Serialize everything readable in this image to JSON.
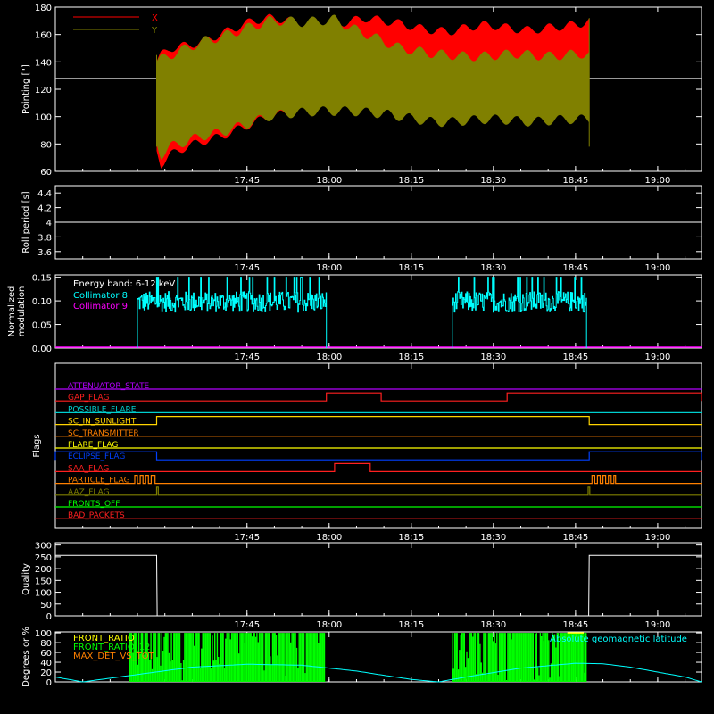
{
  "time_axis": {
    "tick_labels": [
      "17:45",
      "18:00",
      "18:15",
      "18:30",
      "18:45",
      "19:00"
    ],
    "tick_minutes": [
      1065,
      1080,
      1095,
      1110,
      1125,
      1140
    ],
    "range_minutes": [
      1030,
      1148
    ]
  },
  "chart_data": [
    {
      "id": "pointing",
      "type": "area",
      "ylabel": "Pointing [\"]",
      "ylim": [
        60,
        180
      ],
      "yticks": [
        60,
        80,
        100,
        120,
        140,
        160,
        180
      ],
      "legend": [
        {
          "name": "X",
          "color": "#ff0000"
        },
        {
          "name": "Y",
          "color": "#808000"
        }
      ],
      "reference_line": 128,
      "series": [
        {
          "name": "X",
          "color": "#ff0000",
          "x": [
            1048.5,
            1049.3,
            1051,
            1054,
            1057,
            1060,
            1063,
            1066,
            1069,
            1072,
            1075,
            1078,
            1081,
            1084,
            1087,
            1090,
            1093,
            1096,
            1099,
            1102,
            1105,
            1108,
            1111,
            1114,
            1117,
            1120,
            1123,
            1126,
            1127.5
          ],
          "upper": [
            140,
            145,
            150,
            152,
            155,
            160,
            165,
            170,
            172,
            171,
            168,
            165,
            167,
            170,
            172,
            170,
            168,
            165,
            163,
            162,
            165,
            167,
            166,
            164,
            163,
            165,
            166,
            168,
            170
          ],
          "lower": [
            75,
            65,
            72,
            78,
            82,
            85,
            90,
            95,
            100,
            102,
            104,
            105,
            106,
            108,
            110,
            112,
            118,
            122,
            125,
            126,
            128,
            130,
            131,
            130,
            129,
            130,
            131,
            130,
            128
          ]
        },
        {
          "name": "Y",
          "color": "#808000",
          "x": [
            1048.5,
            1049.3,
            1051,
            1054,
            1057,
            1060,
            1063,
            1066,
            1069,
            1072,
            1075,
            1078,
            1081,
            1084,
            1087,
            1090,
            1093,
            1096,
            1099,
            1102,
            1105,
            1108,
            1111,
            1114,
            1117,
            1120,
            1123,
            1126,
            1127.5
          ],
          "upper": [
            140,
            142,
            145,
            150,
            155,
            158,
            162,
            166,
            170,
            170,
            169,
            170,
            171,
            165,
            160,
            155,
            150,
            148,
            146,
            145,
            144,
            144,
            145,
            146,
            145,
            144,
            145,
            146,
            145
          ],
          "lower": [
            80,
            72,
            78,
            82,
            86,
            88,
            92,
            96,
            100,
            102,
            103,
            104,
            104,
            104,
            103,
            102,
            100,
            98,
            96,
            96,
            97,
            98,
            98,
            97,
            96,
            97,
            98,
            98,
            98
          ]
        }
      ]
    },
    {
      "id": "roll",
      "type": "line",
      "ylabel": "Roll period [s]",
      "ylim": [
        3.5,
        4.5
      ],
      "yticks": [
        3.6,
        3.8,
        4.0,
        4.2,
        4.4
      ],
      "series": [
        {
          "name": "",
          "color": "#ffffff",
          "x": [
            1030,
            1148
          ],
          "y": [
            4.0,
            4.0
          ]
        }
      ]
    },
    {
      "id": "modulation",
      "type": "line",
      "ylabel": "Normalized modulation",
      "ylim": [
        0,
        0.155
      ],
      "yticks": [
        0.0,
        0.05,
        0.1,
        0.15
      ],
      "ytick_labels": [
        "0.00",
        "0.05",
        "0.10",
        "0.15"
      ],
      "annotation": "Energy band: 6-12 keV",
      "series": [
        {
          "name": "Collimator 8",
          "color": "#00ffff",
          "segments": [
            [
              1045,
              1079.5
            ],
            [
              1102.5,
              1127
            ]
          ],
          "level": 0.098,
          "noise": 0.022
        },
        {
          "name": "Collimator 9",
          "color": "#ff00ff",
          "x": [
            1030,
            1148
          ],
          "y": [
            0.0,
            0.0
          ]
        }
      ]
    },
    {
      "id": "flags",
      "type": "line",
      "ylabel": "Flags",
      "flags": [
        {
          "name": "ATTENUATOR_STATE",
          "color": "#b400ff",
          "highs": []
        },
        {
          "name": "GAP_FLAG",
          "color": "#ff2020",
          "highs": [
            [
              1079.5,
              1089.5
            ],
            [
              1112.5,
              1148
            ]
          ]
        },
        {
          "name": "POSSIBLE_FLARE",
          "color": "#00d0d0",
          "highs": []
        },
        {
          "name": "SC_IN_SUNLIGHT",
          "color": "#ffd400",
          "highs": [
            [
              1048.5,
              1127.5
            ]
          ]
        },
        {
          "name": "SC_TRANSMITTER",
          "color": "#ff8000",
          "highs": []
        },
        {
          "name": "FLARE_FLAG",
          "color": "#ffff00",
          "highs": []
        },
        {
          "name": "ECLIPSE_FLAG",
          "color": "#0040ff",
          "highs": [
            [
              1030,
              1048.5
            ],
            [
              1127.5,
              1148
            ]
          ]
        },
        {
          "name": "SAA_FLAG",
          "color": "#ff2020",
          "highs": [
            [
              1081,
              1087.5
            ]
          ]
        },
        {
          "name": "PARTICLE_FLAG",
          "color": "#ff8000",
          "highs": [
            [
              1044.5,
              1045
            ],
            [
              1045.5,
              1046
            ],
            [
              1046.5,
              1047
            ],
            [
              1047.5,
              1048.2
            ],
            [
              1128,
              1128.5
            ],
            [
              1129,
              1129.5
            ],
            [
              1130,
              1130.5
            ],
            [
              1131,
              1131.5
            ],
            [
              1132,
              1132.3
            ]
          ]
        },
        {
          "name": "AAZ_FLAG",
          "color": "#808000",
          "highs": [
            [
              1048.5,
              1048.8
            ],
            [
              1127.3,
              1127.6
            ]
          ]
        },
        {
          "name": "FRONTS_OFF",
          "color": "#00ff00",
          "highs": []
        },
        {
          "name": "BAD_PACKETS",
          "color": "#ff2020",
          "highs": []
        }
      ]
    },
    {
      "id": "quality",
      "type": "line",
      "ylabel": "Quality",
      "ylim": [
        0,
        310
      ],
      "yticks": [
        0,
        50,
        100,
        150,
        200,
        250,
        300
      ],
      "series": [
        {
          "name": "",
          "color": "#ffffff",
          "x": [
            1030,
            1048.5,
            1048.6,
            1127.4,
            1127.5,
            1148
          ],
          "y": [
            256,
            256,
            0,
            0,
            256,
            256
          ]
        }
      ]
    },
    {
      "id": "degrees",
      "type": "line",
      "ylabel": "Degrees or %",
      "ylim": [
        0,
        102
      ],
      "yticks": [
        0,
        20,
        40,
        60,
        80,
        100
      ],
      "annotation": "Absolute geomagnetic latitude",
      "series": [
        {
          "name": "FRONT_RATIO",
          "color": "#ffff00"
        },
        {
          "name": "FRONT_RATIO_12",
          "color": "#00ff00",
          "segments": [
            [
              1043.5,
              1079.5
            ],
            [
              1102.5,
              1127
            ]
          ]
        },
        {
          "name": "MAX_DET_VS_TOT",
          "color": "#ff8000"
        },
        {
          "name": "Absolute geomagnetic latitude",
          "color": "#00ffff",
          "x": [
            1030,
            1035,
            1045,
            1055,
            1065,
            1075,
            1085,
            1095,
            1100,
            1105,
            1115,
            1125,
            1130,
            1135,
            1140,
            1145,
            1148
          ],
          "y": [
            10,
            0,
            15,
            30,
            36,
            34,
            22,
            5,
            0,
            10,
            28,
            38,
            37,
            30,
            20,
            10,
            0
          ]
        }
      ]
    }
  ]
}
